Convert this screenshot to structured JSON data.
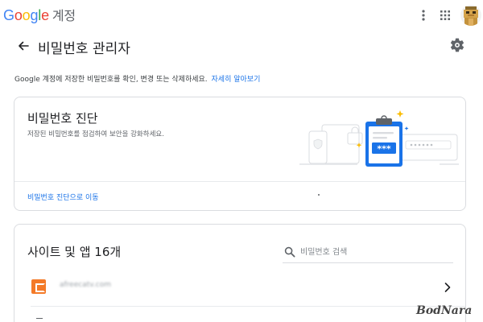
{
  "app": {
    "logo_letters": [
      "G",
      "o",
      "o",
      "g",
      "l",
      "e"
    ],
    "account_label": "계정"
  },
  "topbar": {
    "more_icon": "more-vert-icon",
    "apps_icon": "apps-grid-icon",
    "avatar": "user-avatar"
  },
  "header": {
    "back_icon": "arrow-back-icon",
    "title": "비밀번호 관리자",
    "settings_icon": "gear-icon"
  },
  "intro": {
    "text": "Google 계정에 저장한 비밀번호를 확인, 변경 또는 삭제하세요.",
    "link": "자세히 알아보기"
  },
  "checkup": {
    "title": "비밀번호 진단",
    "subtitle": "저장된 비밀번호를 점검하여 보안을 강화하세요.",
    "link": "비밀번호 진단으로 이동",
    "illustration": "password-checkup-illustration",
    "masked_password": "***"
  },
  "sites": {
    "title": "사이트 및 앱 16개",
    "search_placeholder": "비밀번호 검색",
    "search_icon": "search-icon",
    "items": [
      {
        "name": "afreecatv.com",
        "favicon": "orange-site-favicon",
        "chevron": "chevron-right-icon"
      }
    ]
  },
  "watermark": "BodNara",
  "colors": {
    "accent_blue": "#1a73e8",
    "clipboard_blue": "#1a73e8",
    "star_yellow": "#fbbc04",
    "border": "#dadce0",
    "favicon_orange": "#f47a28"
  }
}
